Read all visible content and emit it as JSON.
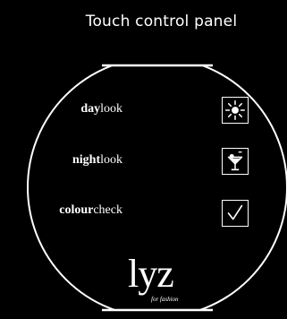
{
  "header": {
    "title": "Touch control panel"
  },
  "rows": [
    {
      "bold": "day",
      "light": "look",
      "icon": "sun-icon"
    },
    {
      "bold": "night",
      "light": "look",
      "icon": "cocktail-glass-icon"
    },
    {
      "bold": "colour",
      "light": "check",
      "icon": "checkmark-icon"
    }
  ],
  "logo": {
    "text": "lyz",
    "tagline": "for fashion"
  },
  "colors": {
    "background": "#000000",
    "foreground": "#ffffff"
  }
}
